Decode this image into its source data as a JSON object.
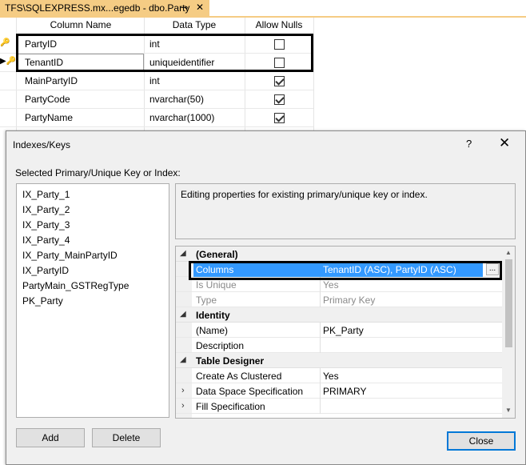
{
  "tab": {
    "title": "TFS\\SQLEXPRESS.mx...egedb - dbo.Party",
    "pin_glyph": "⊸",
    "close_glyph": "✕"
  },
  "table_designer": {
    "headers": [
      "Column Name",
      "Data Type",
      "Allow Nulls"
    ],
    "rows": [
      {
        "name": "PartyID",
        "type": "int",
        "allow_nulls": false,
        "key": true
      },
      {
        "name": "TenantID",
        "type": "uniqueidentifier",
        "allow_nulls": false,
        "key": true
      },
      {
        "name": "MainPartyID",
        "type": "int",
        "allow_nulls": true,
        "key": false
      },
      {
        "name": "PartyCode",
        "type": "nvarchar(50)",
        "allow_nulls": true,
        "key": false
      },
      {
        "name": "PartyName",
        "type": "nvarchar(1000)",
        "allow_nulls": true,
        "key": false
      }
    ]
  },
  "dialog": {
    "title": "Indexes/Keys",
    "help_glyph": "?",
    "close_glyph": "✕",
    "selected_label": "Selected Primary/Unique Key or Index:",
    "items": [
      "IX_Party_1",
      "IX_Party_2",
      "IX_Party_3",
      "IX_Party_4",
      "IX_Party_MainPartyID",
      "IX_PartyID",
      "PartyMain_GSTRegType",
      "PK_Party"
    ],
    "description": "Editing properties for existing primary/unique key or index.",
    "properties": {
      "general": {
        "label": "(General)",
        "columns_label": "Columns",
        "columns_value": "TenantID (ASC), PartyID (ASC)",
        "is_unique_label": "Is Unique",
        "is_unique_value": "Yes",
        "type_label": "Type",
        "type_value": "Primary Key"
      },
      "identity": {
        "label": "Identity",
        "name_label": "(Name)",
        "name_value": "PK_Party",
        "description_label": "Description",
        "description_value": ""
      },
      "table_designer": {
        "label": "Table Designer",
        "create_clustered_label": "Create As Clustered",
        "create_clustered_value": "Yes",
        "data_space_label": "Data Space Specification",
        "data_space_value": "PRIMARY",
        "fill_spec_label": "Fill Specification",
        "fill_spec_value": ""
      }
    },
    "ellipsis": "...",
    "add_label": "Add",
    "delete_label": "Delete",
    "close_label": "Close"
  },
  "colors": {
    "tab_accent": "#f5cc84",
    "selection": "#3399ff",
    "dialog_bg": "#f0f0f0"
  }
}
